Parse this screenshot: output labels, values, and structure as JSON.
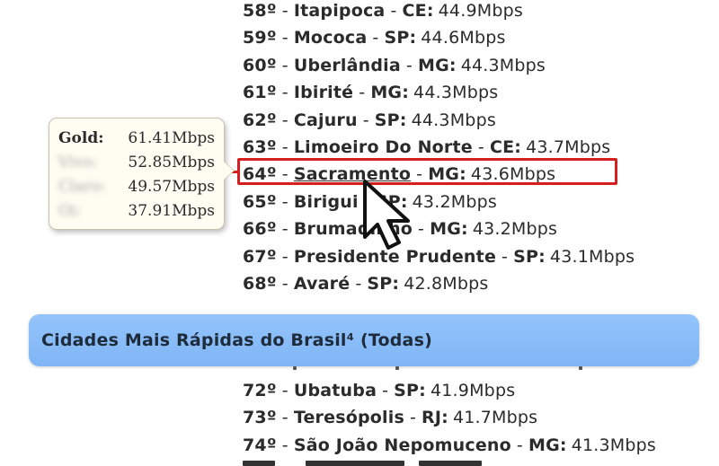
{
  "ranking": {
    "rows": [
      {
        "rank": "58º",
        "city": "Itapipoca",
        "state": "CE:",
        "speed": "44.9Mbps"
      },
      {
        "rank": "59º",
        "city": "Mococa",
        "state": "SP:",
        "speed": "44.6Mbps"
      },
      {
        "rank": "60º",
        "city": "Uberlândia",
        "state": "MG:",
        "speed": "44.3Mbps"
      },
      {
        "rank": "61º",
        "city": "Ibirité",
        "state": "MG:",
        "speed": "44.3Mbps"
      },
      {
        "rank": "62º",
        "city": "Cajuru",
        "state": "SP:",
        "speed": "44.3Mbps"
      },
      {
        "rank": "63º",
        "city": "Limoeiro Do Norte",
        "state": "CE:",
        "speed": "43.7Mbps"
      },
      {
        "rank": "64º",
        "city": "Sacramento",
        "state": "MG:",
        "speed": "43.6Mbps"
      },
      {
        "rank": "65º",
        "city": "Birigui",
        "state": "SP:",
        "speed": "43.2Mbps"
      },
      {
        "rank": "66º",
        "city": "Brumadinho",
        "state": "MG:",
        "speed": "43.2Mbps"
      },
      {
        "rank": "67º",
        "city": "Presidente Prudente",
        "state": "SP:",
        "speed": "43.1Mbps"
      },
      {
        "rank": "68º",
        "city": "Avaré",
        "state": "SP:",
        "speed": "42.8Mbps"
      }
    ],
    "rows_below": [
      {
        "rank": "72º",
        "city": "Ubatuba",
        "state": "SP:",
        "speed": "41.9Mbps"
      },
      {
        "rank": "73º",
        "city": "Teresópolis",
        "state": "RJ:",
        "speed": "41.7Mbps"
      },
      {
        "rank": "74º",
        "city": "São João Nepomuceno",
        "state": "MG:",
        "speed": "41.3Mbps"
      }
    ],
    "separator": "-",
    "highlight_color": "#d51f1f"
  },
  "tooltip": {
    "rows": [
      {
        "label": "Gold:",
        "value": "61.41Mbps"
      },
      {
        "label": "Vivo:",
        "value": "52.85Mbps"
      },
      {
        "label": "Claro:",
        "value": "49.57Mbps"
      },
      {
        "label": "Oi:",
        "value": "37.91Mbps"
      }
    ]
  },
  "banner": {
    "title": "Cidades Mais Rápidas do Brasil⁴ (Todas)",
    "color": "#8cbdf8"
  },
  "icons": {
    "cursor": "arrow-cursor-icon"
  }
}
